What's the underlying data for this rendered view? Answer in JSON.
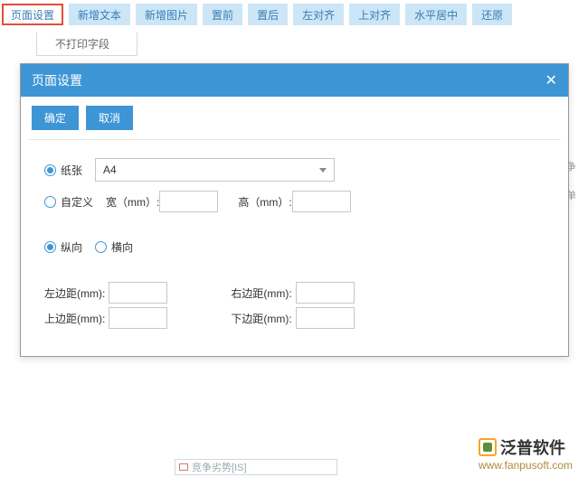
{
  "toolbar": {
    "items": [
      {
        "label": "页面设置",
        "active": true
      },
      {
        "label": "新增文本",
        "active": false
      },
      {
        "label": "新增图片",
        "active": false
      },
      {
        "label": "置前",
        "active": false
      },
      {
        "label": "置后",
        "active": false
      },
      {
        "label": "左对齐",
        "active": false
      },
      {
        "label": "上对齐",
        "active": false
      },
      {
        "label": "水平居中",
        "active": false
      },
      {
        "label": "还原",
        "active": false
      }
    ]
  },
  "sub_label": "不打印字段",
  "dialog": {
    "title": "页面设置",
    "ok": "确定",
    "cancel": "取消",
    "paper_option": "纸张",
    "paper_select": "A4",
    "custom_option": "自定义",
    "width_label": "宽（mm）:",
    "width_value": "",
    "height_label": "高（mm）:",
    "height_value": "",
    "portrait": "纵向",
    "landscape": "横向",
    "margins": {
      "left": {
        "label": "左边距(mm):",
        "value": ""
      },
      "right": {
        "label": "右边距(mm):",
        "value": ""
      },
      "top": {
        "label": "上边距(mm):",
        "value": ""
      },
      "bottom": {
        "label": "下边距(mm):",
        "value": ""
      }
    }
  },
  "bg_text": {
    "a": "缘争",
    "b": "则单"
  },
  "bottom_item": "竞争劣势[IS]",
  "watermark": {
    "name": "泛普软件",
    "url": "www.fanpusoft.com"
  }
}
